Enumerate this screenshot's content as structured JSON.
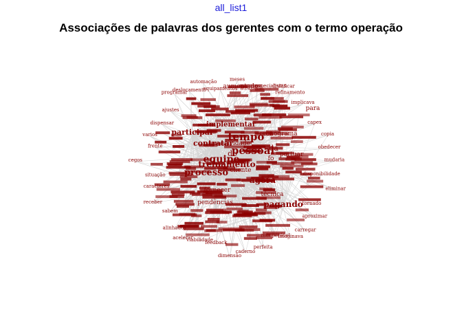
{
  "page": {
    "caption": "all_list1",
    "title": "Associações de palavras dos gerentes com o termo operação"
  },
  "network": {
    "node_color": "#8b0000",
    "edge_color": "#d4d4d4",
    "hub_words": [
      "tempo",
      "pessoal",
      "equipe",
      "processo",
      "treinamento",
      "agora",
      "participar",
      "implementar",
      "contratar",
      "pagando"
    ],
    "major_words": [
      "aumentado",
      "da",
      "do",
      "fo",
      "para",
      "portuar",
      "pendências",
      "fornecer",
      "cronograma",
      "atividade",
      "cliente",
      "técnica"
    ],
    "minor_words": [
      "meses",
      "atrasasse",
      "especialistas",
      "frutificar",
      "refinamento",
      "implicava",
      "capex",
      "copia",
      "obedecer",
      "mudaria",
      "disponibilidade",
      "eliminar",
      "tornado",
      "aproximar",
      "carregar",
      "imaginava",
      "recuperável",
      "perfeita",
      "caderno",
      "dimensão",
      "feedback",
      "viabilidade",
      "acelerar",
      "alinhados",
      "sabem",
      "receber",
      "caracteres",
      "situação",
      "cegos",
      "frente",
      "varios",
      "dispensar",
      "ajustes",
      "programar",
      "deslocamento",
      "automação",
      "equipamentos"
    ]
  }
}
